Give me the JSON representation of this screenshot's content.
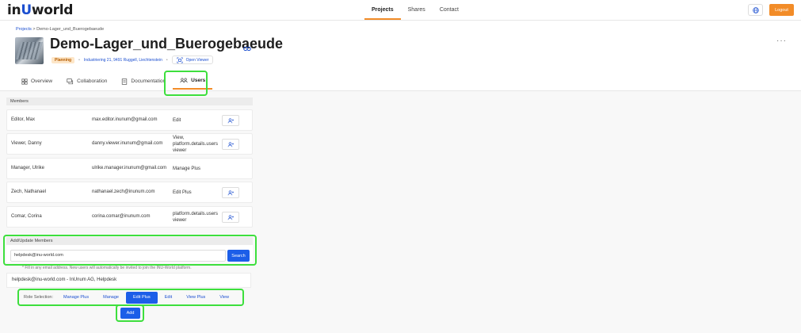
{
  "header": {
    "logo_prefix": "in",
    "logo_u": "U",
    "logo_suffix": "world",
    "nav": [
      "Projects",
      "Shares",
      "Contact"
    ],
    "logout": "Logout"
  },
  "project": {
    "breadcrumb_link": "Projects",
    "breadcrumb_sep": ">",
    "breadcrumb_current": "Demo-Lager_und_Buerogebaeude",
    "title": "Demo-Lager_und_Buerogebaeude",
    "status": "Planning",
    "address": "Industriering 21, 9491 Ruggell, Liechtenstein",
    "open_viewer": "Open Viewer",
    "more": "···"
  },
  "tabs": [
    {
      "label": "Overview"
    },
    {
      "label": "Collaboration"
    },
    {
      "label": "Documentation"
    },
    {
      "label": "Users"
    }
  ],
  "members": {
    "header": "Members",
    "rows": [
      {
        "name": "Editor, Max",
        "email": "max.editor.inunum@gmail.com",
        "role": "Edit"
      },
      {
        "name": "Viewer, Danny",
        "email": "danny.viewer.inunum@gmail.com",
        "role": "View, platform.details.users viewer"
      },
      {
        "name": "Manager, Ulrike",
        "email": "ulrike.manager.inunum@gmail.com",
        "role": "Manage Plus"
      },
      {
        "name": "Zech, Nathanael",
        "email": "nathanael.zech@inunum.com",
        "role": "Edit Plus"
      },
      {
        "name": "Comar, Corina",
        "email": "corina.comar@inunum.com",
        "role": "platform.details.users viewer"
      }
    ]
  },
  "add_update": {
    "header": "Add/Update Members",
    "search_value": "helpdesk@inu-world.com",
    "search_button": "Search",
    "hint": "* Fill in any email address. New users will automatically be invited to join the INU-World platform.",
    "result": "helpdesk@inu-world.com - InUnum AG, Helpdesk",
    "role_label": "Role Selection:",
    "roles": [
      "Manage Plus",
      "Manage",
      "Edit Plus",
      "Edit",
      "View Plus",
      "View"
    ],
    "selected_role": "Edit Plus",
    "add_button": "Add"
  },
  "colors": {
    "accent_orange": "#f28c28",
    "primary_blue": "#1c5ee8",
    "highlight_green": "#3ddf3d"
  }
}
